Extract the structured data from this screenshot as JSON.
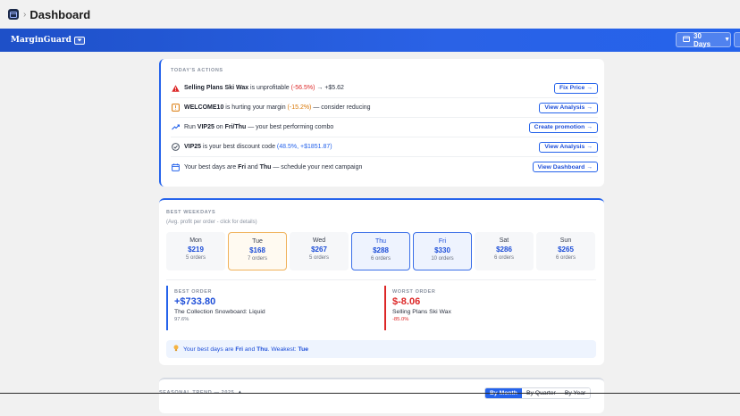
{
  "admin": {
    "title": "Dashboard",
    "separator": "›"
  },
  "header": {
    "brand": "MarginGuard",
    "brand_dropdown_icon": "chevron-down-icon",
    "period": "30 Days",
    "period_caret": "▼"
  },
  "actions": {
    "label": "TODAY'S ACTIONS",
    "items": [
      {
        "icon": "alert-triangle-icon",
        "pre": "",
        "bold1": "Selling Plans Ski Wax",
        "mid": " is unprofitable ",
        "hl": "(-56.5%)",
        "hl_class": "neg",
        "post": " → +$5.62",
        "button": "Fix Price →"
      },
      {
        "icon": "tag-icon",
        "pre": "",
        "bold1": "WELCOME10",
        "mid": " is hurting your margin ",
        "hl": "(-15.2%)",
        "hl_class": "warn",
        "post": " — consider reducing",
        "button": "View Analysis →"
      },
      {
        "icon": "trend-up-icon",
        "pre": "Run ",
        "bold1": "VIP25",
        "mid": " on ",
        "bold2": "Fri/Thu",
        "post": " — your best performing combo",
        "button": "Create promotion →"
      },
      {
        "icon": "check-circle-icon",
        "pre": "",
        "bold1": "VIP25",
        "mid": " is your best discount code ",
        "hl": "(48.5%, +$1851.87)",
        "hl_class": "blue",
        "post": "",
        "button": "View Analysis →"
      },
      {
        "icon": "calendar-icon",
        "pre": "Your best days are ",
        "bold1": "Fri",
        "mid": " and ",
        "bold2": "Thu",
        "post": " — schedule your next campaign",
        "button": "View Dashboard →"
      }
    ]
  },
  "weekdays": {
    "label": "BEST WEEKDAYS",
    "subtitle": "(Avg. profit per order - click for details)",
    "days": [
      {
        "name": "Mon",
        "value": "$219",
        "orders": "5 orders",
        "state": ""
      },
      {
        "name": "Tue",
        "value": "$168",
        "orders": "7 orders",
        "state": "sel-orange"
      },
      {
        "name": "Wed",
        "value": "$267",
        "orders": "5 orders",
        "state": ""
      },
      {
        "name": "Thu",
        "value": "$288",
        "orders": "6 orders",
        "state": "sel-blue"
      },
      {
        "name": "Fri",
        "value": "$330",
        "orders": "10 orders",
        "state": "sel-blue"
      },
      {
        "name": "Sat",
        "value": "$286",
        "orders": "6 orders",
        "state": ""
      },
      {
        "name": "Sun",
        "value": "$265",
        "orders": "6 orders",
        "state": ""
      }
    ],
    "best": {
      "label": "BEST ORDER",
      "value": "+$733.80",
      "name": "The Collection Snowboard: Liquid",
      "pct": "97.6%"
    },
    "worst": {
      "label": "WORST ORDER",
      "value": "$-8.06",
      "name": "Selling Plans Ski Wax",
      "pct": "-85.0%"
    },
    "tip": {
      "pre": "Your best days are ",
      "d1": "Fri",
      "mid": " and ",
      "d2": "Thu",
      "sep": ". Weakest: ",
      "weak": "Tue"
    }
  },
  "trend": {
    "label": "SEASONAL TREND — 2025",
    "toggle_icon": "▲",
    "tabs": [
      "By Month",
      "By Quarter",
      "By Year"
    ],
    "active_tab": 0
  },
  "colors": {
    "accent": "#2563eb",
    "negative": "#dc2626",
    "warning": "#d97706"
  }
}
